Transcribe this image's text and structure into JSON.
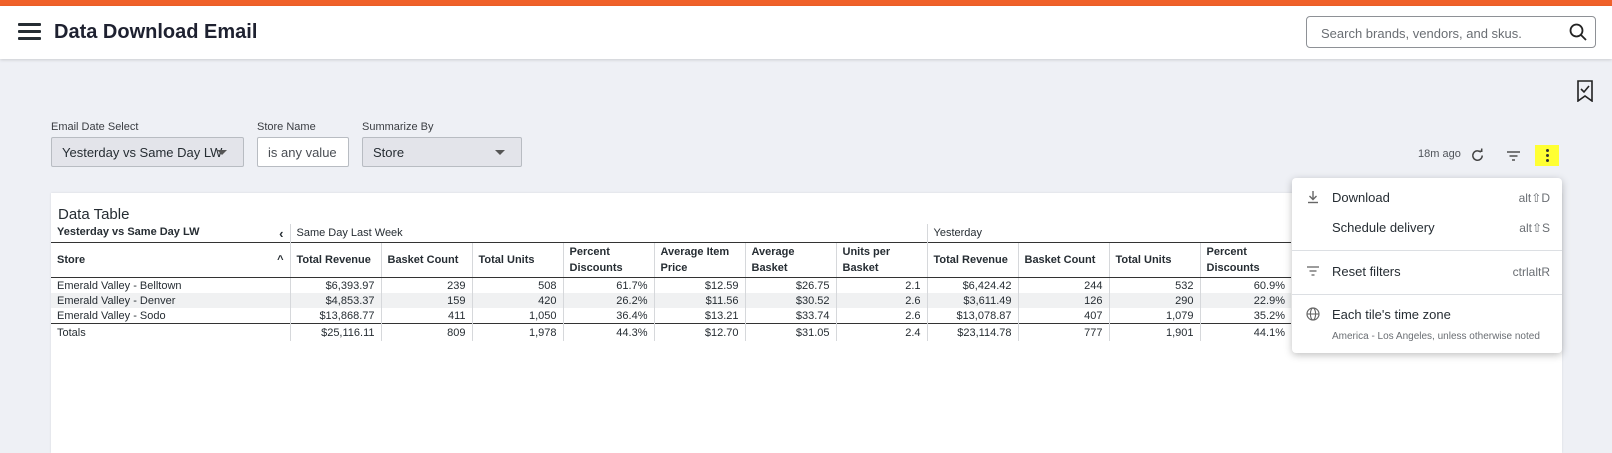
{
  "app": {
    "page_title": "Data Download Email",
    "accent_color": "#f0612a",
    "search_placeholder": "Search brands, vendors, and skus."
  },
  "filters": [
    {
      "label": "Email Date Select",
      "value": "Yesterday vs Same Day LW"
    },
    {
      "label": "Store Name",
      "value": "is any value"
    },
    {
      "label": "Summarize By",
      "value": "Store"
    }
  ],
  "tile_controls": {
    "updated": "18m ago",
    "highlight_color": "#ffff33"
  },
  "tile": {
    "title": "Data Table",
    "pivot_label": "Yesterday vs Same Day LW",
    "pivot_arrow": "‹",
    "groups": [
      "Same Day Last Week",
      "Yesterday"
    ],
    "store_header": "Store",
    "sort_arrow": "^",
    "columns": [
      "Total Revenue",
      "Basket Count",
      "Total Units",
      "Percent Discounts",
      "Average Item Price",
      "Average Basket",
      "Units per Basket",
      "Total Revenue",
      "Basket Count",
      "Total Units",
      "Percent Discounts"
    ],
    "rows": [
      {
        "store": "Emerald Valley - Belltown",
        "cells": [
          "$6,393.97",
          "239",
          "508",
          "61.7%",
          "$12.59",
          "$26.75",
          "2.1",
          "$6,424.42",
          "244",
          "532",
          "60.9%"
        ]
      },
      {
        "store": "Emerald Valley - Denver",
        "cells": [
          "$4,853.37",
          "159",
          "420",
          "26.2%",
          "$11.56",
          "$30.52",
          "2.6",
          "$3,611.49",
          "126",
          "290",
          "22.9%"
        ]
      },
      {
        "store": "Emerald Valley - Sodo",
        "cells": [
          "$13,868.77",
          "411",
          "1,050",
          "36.4%",
          "$13.21",
          "$33.74",
          "2.6",
          "$13,078.87",
          "407",
          "1,079",
          "35.2%"
        ]
      }
    ],
    "totals": {
      "label": "Totals",
      "cells": [
        "$25,116.11",
        "809",
        "1,978",
        "44.3%",
        "$12.70",
        "$31.05",
        "2.4",
        "$23,114.78",
        "777",
        "1,901",
        "44.1%"
      ]
    }
  },
  "menu": {
    "download": {
      "label": "Download",
      "shortcut": "alt⇧D",
      "icon": "download-icon"
    },
    "schedule": {
      "label": "Schedule delivery",
      "shortcut": "alt⇧S"
    },
    "reset": {
      "label": "Reset filters",
      "shortcut": "ctrlaltR",
      "icon": "filter-lines-icon"
    },
    "timezone": {
      "label": "Each tile's time zone",
      "sub": "America - Los Angeles, unless otherwise noted",
      "icon": "globe-icon"
    }
  }
}
